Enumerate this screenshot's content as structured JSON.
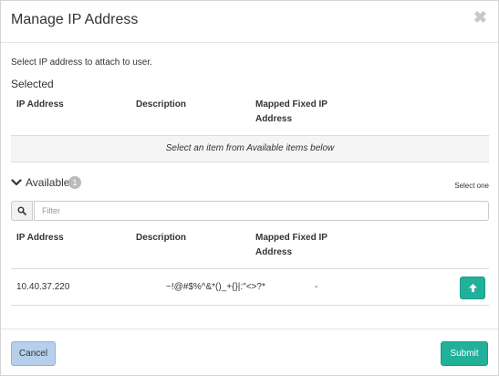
{
  "modal": {
    "title": "Manage IP Address",
    "close_glyph": "✖",
    "intro": "Select IP address to attach to user."
  },
  "selected": {
    "label": "Selected",
    "columns": [
      "IP Address",
      "Description",
      "Mapped Fixed IP Address"
    ],
    "empty_text": "Select an item from Available items below"
  },
  "available": {
    "label": "Available",
    "count": "1",
    "select_hint": "Select one",
    "filter_placeholder": "Filter",
    "columns": [
      "IP Address",
      "Description",
      "Mapped Fixed IP Address"
    ],
    "rows": [
      {
        "ip": "10.40.37.220",
        "description": "~!@#$%^&*()_+{}|:\"<>?*",
        "mapped": "-"
      }
    ]
  },
  "icons": {
    "chevron": "chevron-down-icon",
    "search": "search-icon",
    "add": "arrow-up-icon"
  },
  "footer": {
    "cancel_label": "Cancel",
    "submit_label": "Submit"
  },
  "colors": {
    "primary": "#21b19b",
    "cancel_bg": "#b6cfea",
    "badge": "#bbbbbb"
  }
}
